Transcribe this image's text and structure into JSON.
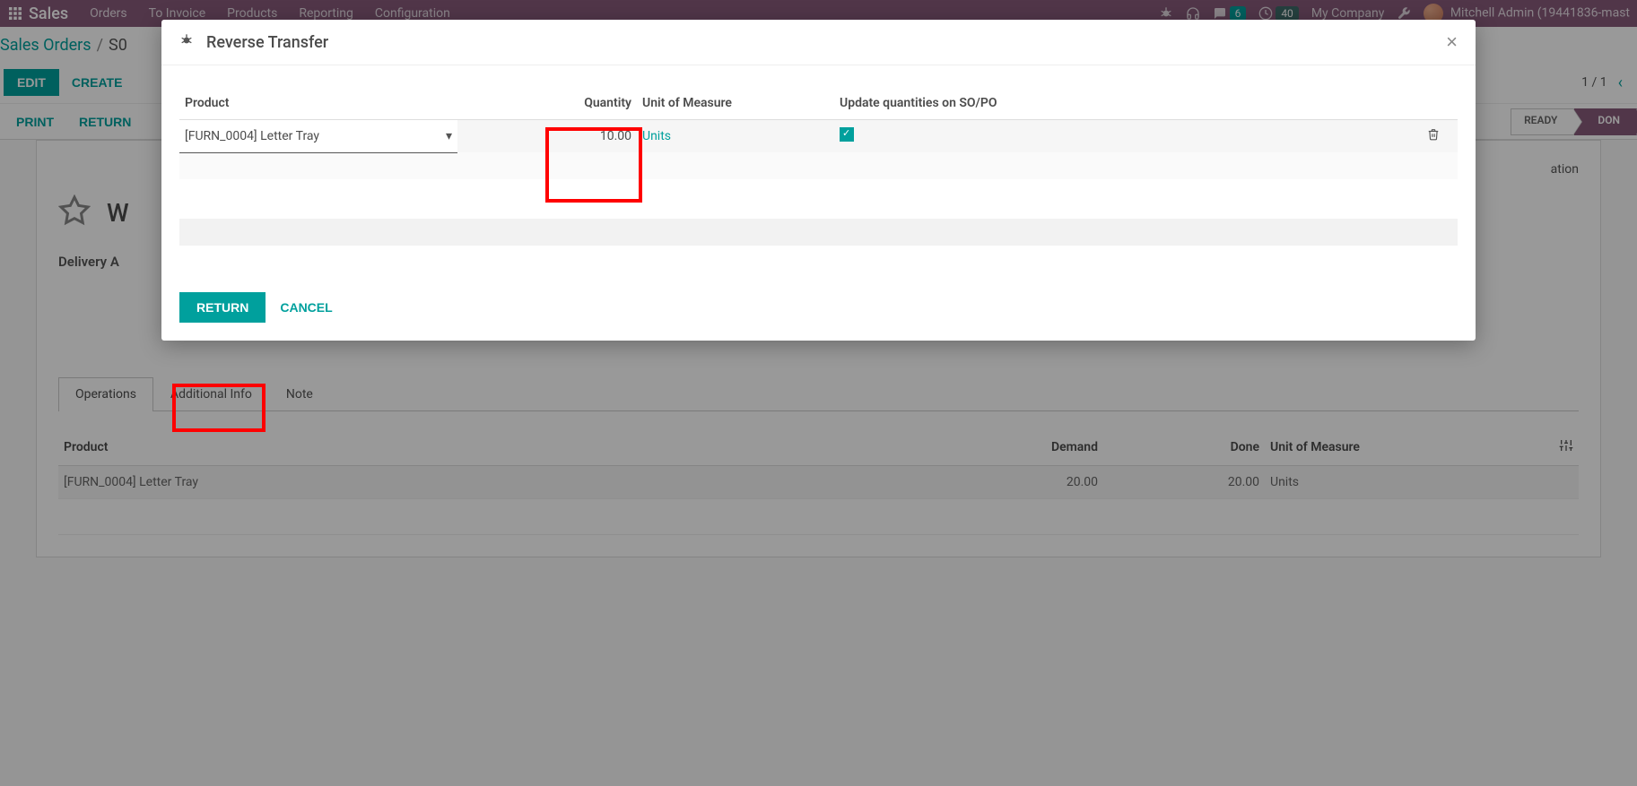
{
  "topnav": {
    "brand": "Sales",
    "menu": [
      "Orders",
      "To Invoice",
      "Products",
      "Reporting",
      "Configuration"
    ],
    "msg_count": "6",
    "activity_count": "40",
    "company": "My Company",
    "user": "Mitchell Admin (19441836-mast"
  },
  "breadcrumb": {
    "root": "Sales Orders",
    "sep": "/",
    "current": "S0"
  },
  "toolbar": {
    "edit": "Edit",
    "create": "Create",
    "pager": "1 / 1",
    "print": "Print",
    "return": "Return"
  },
  "status": {
    "ready": "READY",
    "done": "DON"
  },
  "sheet": {
    "stat_label": "ation",
    "title_initial": "W",
    "delivery_label": "Delivery A"
  },
  "tabs": {
    "operations": "Operations",
    "additional": "Additional Info",
    "note": "Note"
  },
  "table": {
    "h_product": "Product",
    "h_demand": "Demand",
    "h_done": "Done",
    "h_uom": "Unit of Measure",
    "rows": [
      {
        "product": "[FURN_0004] Letter Tray",
        "demand": "20.00",
        "done": "20.00",
        "uom": "Units"
      }
    ]
  },
  "modal": {
    "title": "Reverse Transfer",
    "h_product": "Product",
    "h_qty": "Quantity",
    "h_uom": "Unit of Measure",
    "h_update": "Update quantities on SO/PO",
    "row_product": "[FURN_0004] Letter Tray",
    "row_qty": "10.00",
    "row_uom": "Units",
    "btn_return": "Return",
    "btn_cancel": "Cancel"
  }
}
